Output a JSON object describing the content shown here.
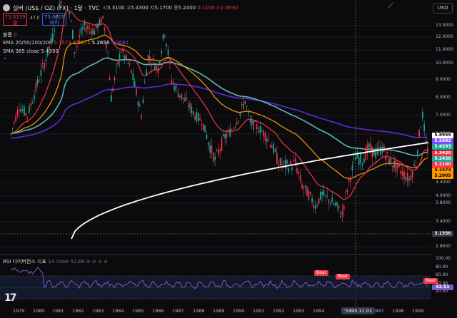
{
  "header": {
    "title": "실버 (US$ / OZ) (FX) · 1달 · TVC",
    "ohlc": {
      "o_label": "시",
      "o": "5.3100",
      "h_label": "고",
      "h": "5.4300",
      "l_label": "저",
      "l": "5.1700",
      "c_label": "종",
      "c": "5.2400",
      "chg": "0.1100 (-2.06%)"
    }
  },
  "price_boxes": {
    "sell_value": "73.0139",
    "sell_label": "셀",
    "spread": "47.0",
    "buy_value": "73.0609",
    "buy_label": "바이"
  },
  "indicators": {
    "volume": {
      "label": "볼륨",
      "value": "0"
    },
    "ema": {
      "label": "EMA 20/50/100/200",
      "v1": "5.1573",
      "v2": "4.9671",
      "v3": "5.2656",
      "v4": "5.5682"
    },
    "sma": {
      "label": "SMA 365 close",
      "value": "5.4393"
    },
    "rsi": {
      "label": "RSI 다이버전스 지표",
      "params": "14 close",
      "value": "52.66"
    }
  },
  "currency_button": "USD",
  "y_axis_labels": [
    {
      "t": "13.0000",
      "p": 13.0
    },
    {
      "t": "12.0000",
      "p": 12.0
    },
    {
      "t": "11.0000",
      "p": 11.0
    },
    {
      "t": "10.0000",
      "p": 10.0
    },
    {
      "t": "9.0000",
      "p": 9.0
    },
    {
      "t": "8.0000",
      "p": 8.0
    },
    {
      "t": "7.0000",
      "p": 7.0
    },
    {
      "t": "6.0000",
      "p": 6.0
    },
    {
      "t": "4.8000",
      "p": 4.8
    },
    {
      "t": "4.4000",
      "p": 4.4
    },
    {
      "t": "4.0000",
      "p": 4.0
    },
    {
      "t": "3.8000",
      "p": 3.8
    },
    {
      "t": "3.4000",
      "p": 3.4
    },
    {
      "t": "2.8600",
      "p": 2.86
    }
  ],
  "price_tags": [
    {
      "t": "5.8959",
      "bg": "#ffffff",
      "fg": "#000000",
      "p": 5.8959
    },
    {
      "t": "5.5682",
      "bg": "#7c4dff",
      "fg": "#ffffff",
      "p": 5.5682
    },
    {
      "t": "5.4393",
      "bg": "#26a69a",
      "fg": "#ffffff",
      "p": 5.4393
    },
    {
      "t": "5.3420",
      "bg": "#f23645",
      "fg": "#ffffff",
      "p": 5.342
    },
    {
      "t": "5.2436",
      "bg": "#26a69a",
      "fg": "#ffffff",
      "p": 5.2436
    },
    {
      "t": "5.2100",
      "bg": "#f23645",
      "fg": "#ffffff",
      "p": 5.21
    },
    {
      "t": "5.1573",
      "bg": "#ff9800",
      "fg": "#000000",
      "p": 5.1573
    },
    {
      "t": "5.2009",
      "bg": "#ff9800",
      "fg": "#000000",
      "p": 5.05
    }
  ],
  "crosshair_price": "3.1356",
  "rsi_axis_labels": [
    "100.00",
    "80.00",
    "60.00",
    "40.00",
    "20.00"
  ],
  "rsi_tag": "52.51",
  "bear_labels": [
    "Bear",
    "Bear",
    "Bear"
  ],
  "x_axis_labels": [
    "1979",
    "1980",
    "1981",
    "1982",
    "1983",
    "1984",
    "1985",
    "1986",
    "1987",
    "1988",
    "1989",
    "1990",
    "1991",
    "1992",
    "1993",
    "1994",
    "1996",
    "1997",
    "1998",
    "1999"
  ],
  "crosshair_date": "'1995 11 01",
  "colors": {
    "up": "#26a69a",
    "down": "#f23645",
    "ema20": "#f23645",
    "ema50": "#ff9800",
    "ema100": "#5fb8b2",
    "ema200": "#5b2bd6",
    "sma365": "#ffffff",
    "rsi": "#7e57c2",
    "bg": "#0b0b0d"
  }
}
